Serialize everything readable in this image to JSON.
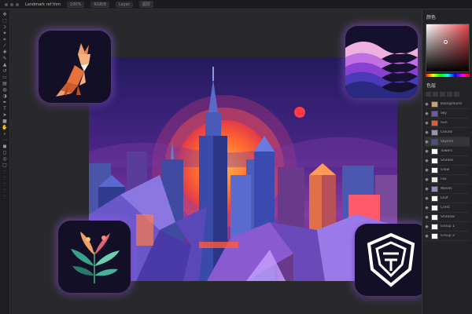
{
  "window": {
    "tabs": [
      "Landmark ref thm",
      "100%",
      "RGB/8",
      "Layer",
      "图层"
    ],
    "active_tab": 0
  },
  "toolbar": {
    "tools": [
      {
        "name": "move-tool-icon",
        "glyph": "✥"
      },
      {
        "name": "marquee-tool-icon",
        "glyph": "⬚"
      },
      {
        "name": "lasso-tool-icon",
        "glyph": "ↄ"
      },
      {
        "name": "magic-wand-icon",
        "glyph": "✦"
      },
      {
        "name": "crop-tool-icon",
        "glyph": "⌗"
      },
      {
        "name": "eyedropper-icon",
        "glyph": "⁄"
      },
      {
        "name": "healing-brush-icon",
        "glyph": "✚"
      },
      {
        "name": "brush-tool-icon",
        "glyph": "✎"
      },
      {
        "name": "clone-stamp-icon",
        "glyph": "▲"
      },
      {
        "name": "history-brush-icon",
        "glyph": "↺"
      },
      {
        "name": "eraser-tool-icon",
        "glyph": "▭"
      },
      {
        "name": "gradient-tool-icon",
        "glyph": "▤"
      },
      {
        "name": "blur-tool-icon",
        "glyph": "◍"
      },
      {
        "name": "dodge-tool-icon",
        "glyph": "◑"
      },
      {
        "name": "pen-tool-icon",
        "glyph": "✒"
      },
      {
        "name": "type-tool-icon",
        "glyph": "T"
      },
      {
        "name": "path-select-icon",
        "glyph": "➤"
      },
      {
        "name": "shape-tool-icon",
        "glyph": "■"
      },
      {
        "name": "hand-tool-icon",
        "glyph": "✋"
      },
      {
        "name": "zoom-tool-icon",
        "glyph": "⌕"
      },
      {
        "name": "edit-toolbar-icon",
        "glyph": "⋯"
      },
      {
        "name": "foreground-color-icon",
        "glyph": "◼"
      },
      {
        "name": "background-color-icon",
        "glyph": "◻"
      },
      {
        "name": "quick-mask-icon",
        "glyph": "◎"
      },
      {
        "name": "screen-mode-icon",
        "glyph": "▢"
      },
      {
        "name": "tool-extra-1-icon",
        "glyph": "·"
      },
      {
        "name": "tool-extra-2-icon",
        "glyph": "·"
      },
      {
        "name": "tool-extra-3-icon",
        "glyph": "·"
      },
      {
        "name": "tool-extra-4-icon",
        "glyph": "·"
      },
      {
        "name": "tool-extra-5-icon",
        "glyph": "·"
      }
    ]
  },
  "panel": {
    "color_title": "颜色",
    "layers_title": "色层",
    "layers": [
      {
        "label": "Background",
        "color": "#c9a27a"
      },
      {
        "label": "Sky",
        "color": "#6a5aa8"
      },
      {
        "label": "Sun",
        "color": "#e05c3a"
      },
      {
        "label": "Clouds",
        "color": "#9a92b8"
      },
      {
        "label": "Skyline",
        "color": "#4a4f8a"
      },
      {
        "label": "Towers",
        "color": "#ffffff"
      },
      {
        "label": "Shades",
        "color": "#ffffff"
      },
      {
        "label": "Glow",
        "color": "#ffffff"
      },
      {
        "label": "Fox",
        "color": "#e8e8ea"
      },
      {
        "label": "Waves",
        "color": "#8a8fc0"
      },
      {
        "label": "Leaf",
        "color": "#ffffff"
      },
      {
        "label": "Crest",
        "color": "#ffffff"
      },
      {
        "label": "Shadow",
        "color": "#ffffff"
      },
      {
        "label": "Group 1",
        "color": "#ffffff"
      },
      {
        "label": "Group 2",
        "color": "#ffffff"
      }
    ]
  },
  "colors": {
    "accent_glow": "#aa6eff",
    "sun": "#ff5a2a",
    "sky_top": "#2a1e64",
    "sky_mid": "#6a2ea0"
  }
}
